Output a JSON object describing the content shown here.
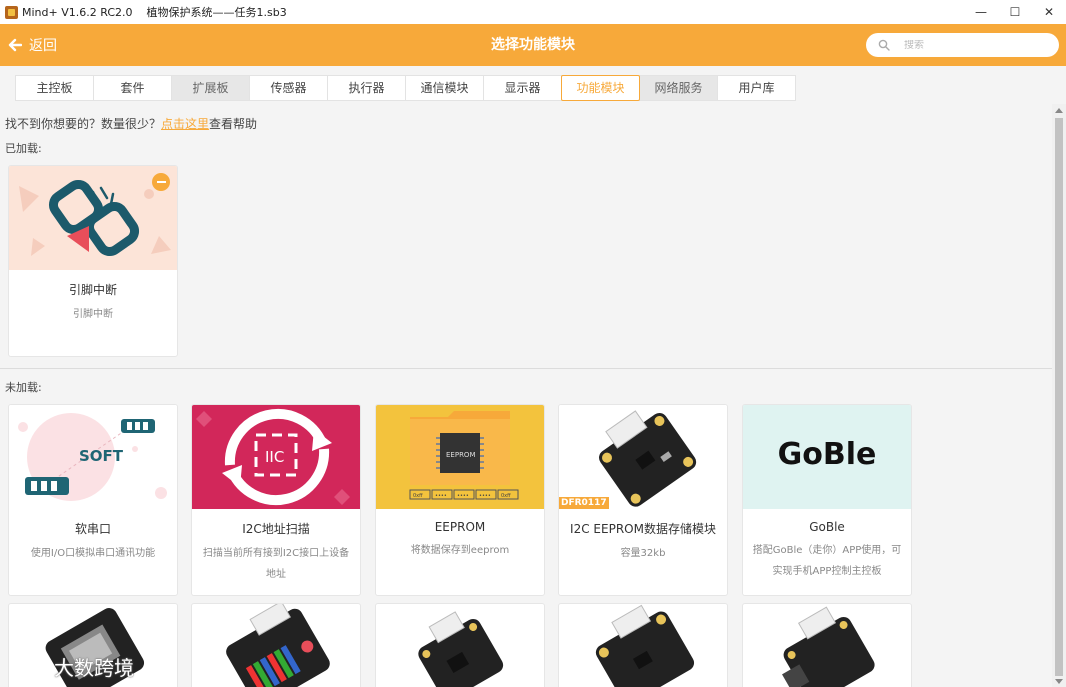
{
  "window": {
    "title": "Mind+ V1.6.2 RC2.0    植物保护系统——任务1.sb3",
    "controls": [
      "—",
      "☐",
      "✕"
    ]
  },
  "header": {
    "back_label": "返回",
    "title": "选择功能模块",
    "search_placeholder": "搜索"
  },
  "tabs": [
    {
      "label": "主控板",
      "state": "normal"
    },
    {
      "label": "套件",
      "state": "normal"
    },
    {
      "label": "扩展板",
      "state": "dim"
    },
    {
      "label": "传感器",
      "state": "normal"
    },
    {
      "label": "执行器",
      "state": "normal"
    },
    {
      "label": "通信模块",
      "state": "normal"
    },
    {
      "label": "显示器",
      "state": "normal"
    },
    {
      "label": "功能模块",
      "state": "active"
    },
    {
      "label": "网络服务",
      "state": "dim"
    },
    {
      "label": "用户库",
      "state": "normal"
    }
  ],
  "hint": {
    "prefix": "找不到你想要的？数量很少？",
    "link": "点击这里",
    "suffix": "查看帮助"
  },
  "loaded": {
    "label": "已加载:",
    "items": [
      {
        "name": "引脚中断",
        "desc": "引脚中断"
      }
    ]
  },
  "unloaded": {
    "label": "未加载:",
    "items": [
      {
        "name": "软串口",
        "desc": "使用I/O口模拟串口通讯功能",
        "thumb_text": "SOFT"
      },
      {
        "name": "I2C地址扫描",
        "desc": "扫描当前所有接到I2C接口上设备地址",
        "thumb_text": "IIC"
      },
      {
        "name": "EEPROM",
        "desc": "将数据保存到eeprom",
        "thumb_text": "EEPROM",
        "chip_labels": [
          "0xff",
          "••••",
          "••••",
          "••••",
          "0xff"
        ]
      },
      {
        "name": "I2C EEPROM数据存储模块",
        "desc": "容量32kb",
        "thumb_text": "DFR0117"
      },
      {
        "name": "GoBle",
        "desc": "搭配GoBle（走你）APP使用，可实现手机APP控制主控板",
        "thumb_text": "GoBle"
      }
    ]
  },
  "watermark": "大数跨境",
  "colors": {
    "accent": "#f7a93a",
    "pink": "#d2275a",
    "yellow": "#f3c33d",
    "mint": "#dff3f1"
  }
}
